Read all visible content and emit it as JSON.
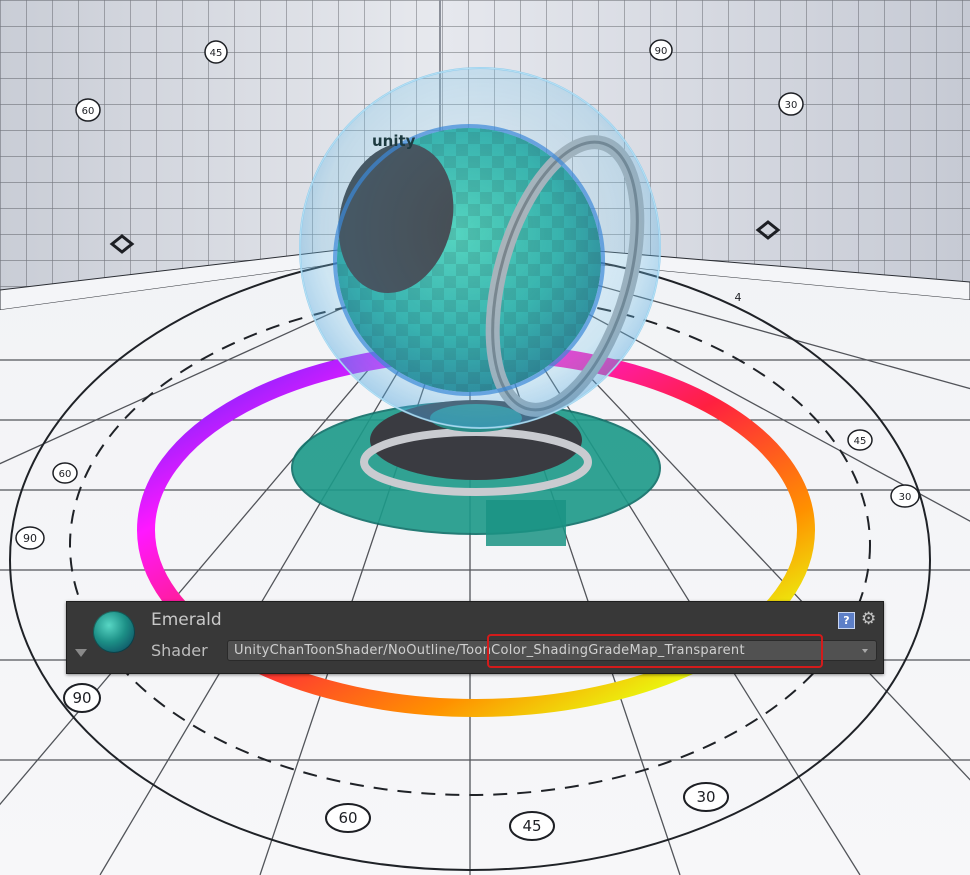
{
  "scene": {
    "angle_labels": [
      "90",
      "60",
      "45",
      "30",
      "90",
      "60",
      "45",
      "30",
      "45",
      "30",
      "60",
      "90",
      "4"
    ],
    "logo_text": "unity"
  },
  "material_header": {
    "name": "Emerald",
    "shader_label": "Shader",
    "shader_path_prefix": "UnityChanToonShader/NoOutline/",
    "shader_name": "ToonColor_ShadingGradeMap_Transparent",
    "help_icon": "?",
    "gear_icon": "⚙"
  },
  "colors": {
    "panel_bg": "#383838",
    "highlight": "#d31b1b",
    "help_icon": "#5d7fc7"
  }
}
